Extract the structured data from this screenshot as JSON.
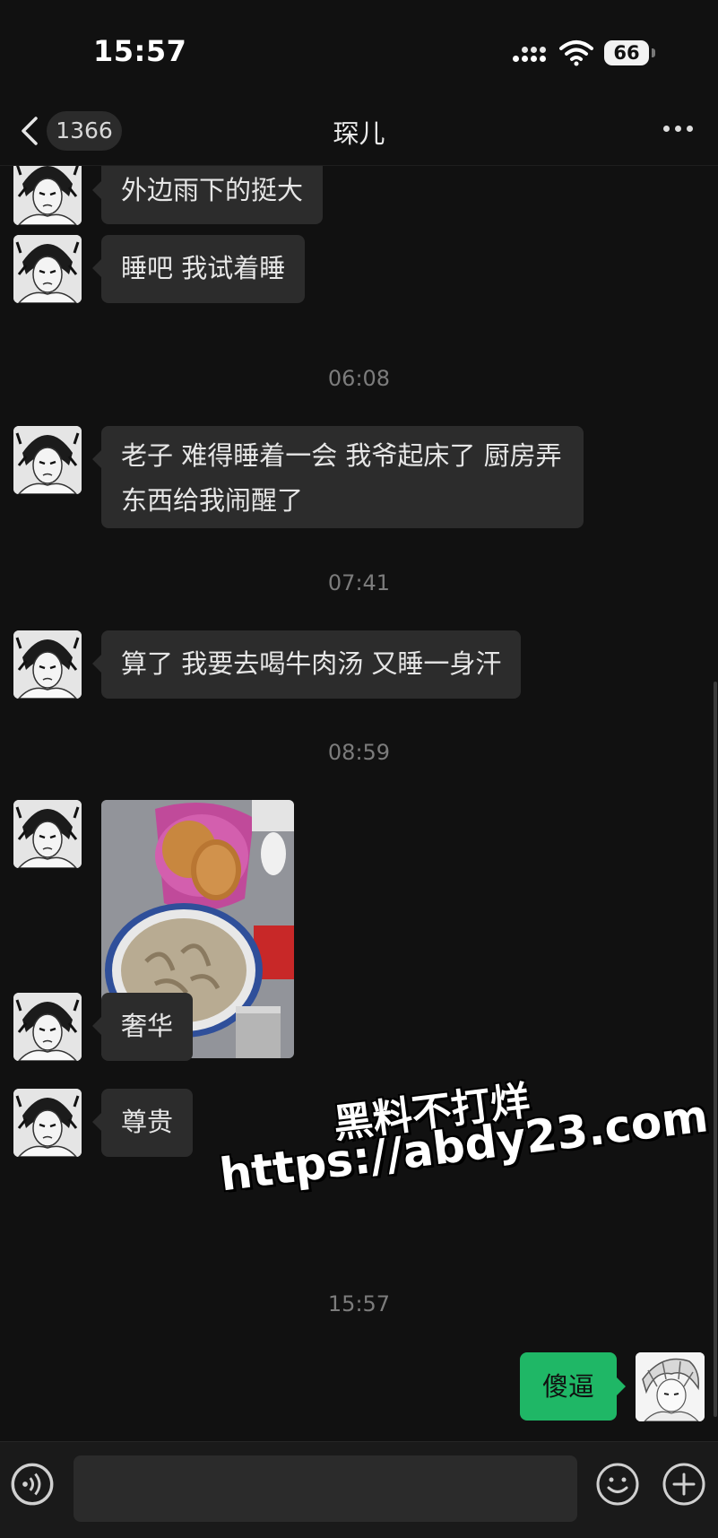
{
  "status_bar": {
    "time": "15:57",
    "battery": "66"
  },
  "nav": {
    "unread_count": "1366",
    "title": "琛儿"
  },
  "messages": [
    {
      "time": null,
      "text": "外边雨下的挺大"
    },
    {
      "time": null,
      "text": "睡吧 我试着睡"
    },
    {
      "time": "06:08",
      "text": "老子 难得睡着一会 我爷起床了 厨房弄东西给我闹醒了"
    },
    {
      "time": "07:41",
      "text": "算了 我要去喝牛肉汤 又睡一身汗"
    },
    {
      "time": "08:59",
      "photo": "beef-soup-and-flatbread-photo"
    },
    {
      "time": null,
      "text": "奢华"
    },
    {
      "time": null,
      "text": "尊贵"
    },
    {
      "time": "15:57",
      "text": "傻逼",
      "from_me": true
    }
  ],
  "watermark": {
    "line1": "黑料不打烊",
    "line2": "https://abdy23.com"
  },
  "input_bar": {
    "placeholder": "",
    "value": ""
  },
  "icons": [
    "back-chevron-icon",
    "more-icon",
    "voice-icon",
    "emoji-icon",
    "plus-icon",
    "wifi-icon",
    "signal-icon",
    "battery-icon"
  ],
  "colors": {
    "background": "#111111",
    "bubble_other": "#2c2c2c",
    "bubble_me": "#1fb766",
    "text": "#e6e6e6",
    "timestamp": "#7c7c7c"
  }
}
